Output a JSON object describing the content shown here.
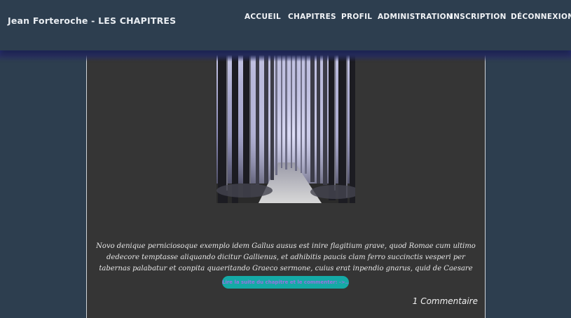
{
  "site": {
    "title": "Jean Forteroche - LES CHAPITRES"
  },
  "nav": {
    "items": [
      {
        "label": "ACCUEIL"
      },
      {
        "label": "CHAPITRES"
      },
      {
        "label": "PROFIL"
      },
      {
        "label": "ADMINISTRATION"
      },
      {
        "label": "INSCRIPTION"
      },
      {
        "label": "DÉCONNEXION"
      }
    ]
  },
  "chapter": {
    "image_icon": "forest-path-photo",
    "excerpt": "Novo denique perniciosoque exemplo idem Gallus ausus est inire flagitium grave, quod Romae cum ultimo dedecore temptasse aliquando dicitur Gallienus, et adhibitis paucis clam ferro succinctis vesperi per tabernas palabatur et conpita quaeritando Graeco sermone, cuius erat inpendio gnarus, quid de Caesare quisque sentiret. ...",
    "read_more_label": "Lire la suite du chapitre et le commenter: ->...",
    "comments_label": "1 Commentaire"
  },
  "colors": {
    "background": "#2d3e4f",
    "content_panel": "#353535",
    "button": "#14aaa6",
    "button_text": "#9a72e0"
  }
}
